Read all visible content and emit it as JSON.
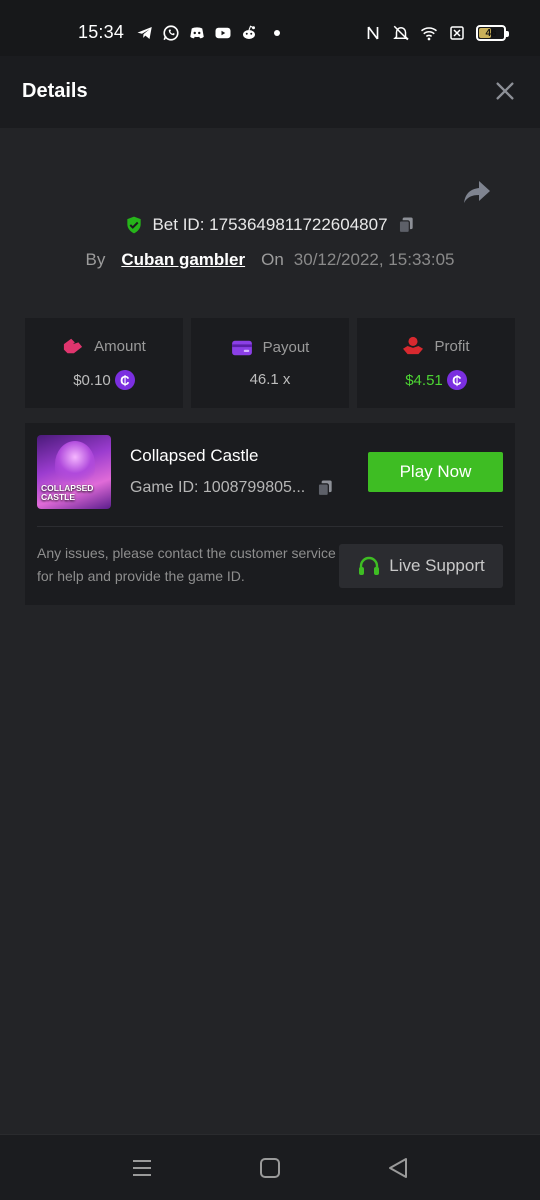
{
  "status_bar": {
    "time": "15:34",
    "battery": "46",
    "battery_level": 0.46,
    "notification_icons": [
      "telegram-icon",
      "whatsapp-icon",
      "discord-icon",
      "youtube-icon",
      "reddit-icon"
    ],
    "system_icons": [
      "nfc-icon",
      "bell-off-icon",
      "wifi-icon",
      "sim-off-icon",
      "battery-icon"
    ]
  },
  "header": {
    "title": "Details"
  },
  "bet": {
    "id_text": "Bet ID: 1753649811722604807",
    "by_label": "By",
    "user": "Cuban gambler",
    "on_label": "On",
    "date": "30/12/2022, 15:33:05"
  },
  "stats": {
    "amount_label": "Amount",
    "amount_value": "$0.10",
    "payout_label": "Payout",
    "payout_value": "46.1 x",
    "profit_label": "Profit",
    "profit_value": "$4.51",
    "coin_symbol": "₵"
  },
  "game": {
    "thumbnail_text": "COLLAPSED CASTLE",
    "title": "Collapsed Castle",
    "id_text": "Game ID: 1008799805...",
    "play_label": "Play Now",
    "help_text": "Any issues, please contact the customer service for help and provide the game ID.",
    "support_label": "Live Support"
  },
  "colors": {
    "background": "#232427",
    "card": "#1b1c1f",
    "accent_green": "#3ebd23",
    "profit_green": "#4cd433",
    "coin_purple": "#7b2fe0",
    "shield_green": "#26b51a"
  }
}
